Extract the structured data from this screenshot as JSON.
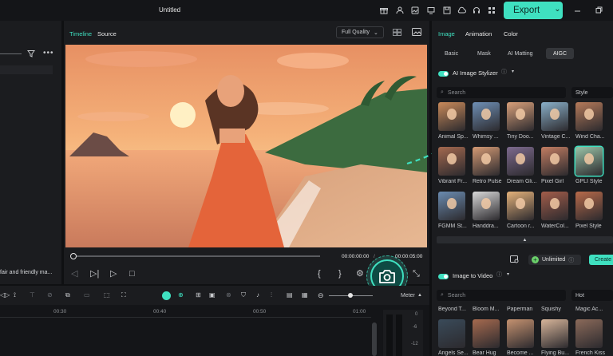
{
  "window": {
    "title": "Untitled"
  },
  "topbar": {
    "export_label": "Export",
    "export_caret": "⌄"
  },
  "left_panel": {
    "clip_text": "fair and friendly ma..."
  },
  "player": {
    "tabs": [
      "Timeline",
      "Source"
    ],
    "quality": "Full Quality",
    "time_current": "00:00:00:00",
    "time_total": "00:00:05:00",
    "progress": 0
  },
  "right_panel": {
    "tabs": [
      "Image",
      "Animation",
      "Color"
    ],
    "subtabs": [
      "Basic",
      "Mask",
      "AI Matting",
      "AIGC"
    ],
    "stylizer_title": "AI Image Stylizer",
    "search_placeholder": "Search",
    "style_dropdown": "Style",
    "style_items": [
      "Animal Sp...",
      "Whimsy ...",
      "Tiny Doo...",
      "Vintage C...",
      "Wind Cha...",
      "Vibrant Fr...",
      "Retro Pulse",
      "Dream Gli...",
      "Pixel Girl",
      "GPLI Style",
      "FGMM St...",
      "Handdra...",
      "Cartoon r...",
      "WaterCol...",
      "Pixel Style"
    ],
    "unlimited_label": "Unlimited",
    "create_label": "Create",
    "i2v_title": "Image to Video",
    "i2v_search_placeholder": "Search",
    "hot_dropdown": "Hot",
    "i2v_items_top": [
      "Beyond T...",
      "Bloom M...",
      "Paperman",
      "Squishy",
      "Magic Ac..."
    ],
    "i2v_items_bottom": [
      "Angels Se...",
      "Bear Hug",
      "Become ...",
      "Flying Bu...",
      "French Kiss"
    ]
  },
  "timeline": {
    "ruler": [
      "00:30",
      "00:40",
      "00:50",
      "01:00"
    ],
    "meter_label": "Meter",
    "meter_ticks": [
      "0",
      "-6",
      "-12"
    ]
  }
}
